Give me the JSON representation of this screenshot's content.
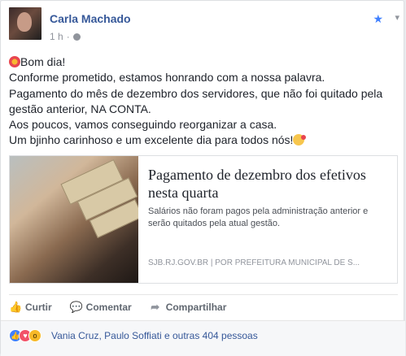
{
  "post": {
    "author": "Carla Machado",
    "time": "1 h",
    "lines": [
      "Bom dia!",
      "Conforme prometido, estamos honrando com a nossa palavra.",
      "Pagamento do mês de dezembro dos servidores, que não foi quitado pela gestão anterior, NA CONTA.",
      "Aos poucos, vamos conseguindo reorganizar a casa.",
      "Um bjinho carinhoso e um excelente dia para todos nós!"
    ]
  },
  "link": {
    "title": "Pagamento de dezembro dos efetivos nesta quarta",
    "description": "Salários não foram pagos pela administração anterior e serão quitados pela atual gestão.",
    "source": "SJB.RJ.GOV.BR  |  POR PREFEITURA MUNICIPAL DE S..."
  },
  "actions": {
    "like": "Curtir",
    "comment": "Comentar",
    "share": "Compartilhar"
  },
  "reactions": {
    "summary": "Vania Cruz, Paulo Soffiati e outras 404 pessoas"
  },
  "icons": {
    "star": "star-icon",
    "globe": "globe-icon",
    "chevron": "chevron-down-icon",
    "like": "thumbs-up-icon",
    "comment": "comment-icon",
    "share": "share-arrow-icon"
  },
  "colors": {
    "link": "#365899",
    "accent": "#4080ff",
    "text": "#1d2129",
    "muted": "#90949c"
  }
}
